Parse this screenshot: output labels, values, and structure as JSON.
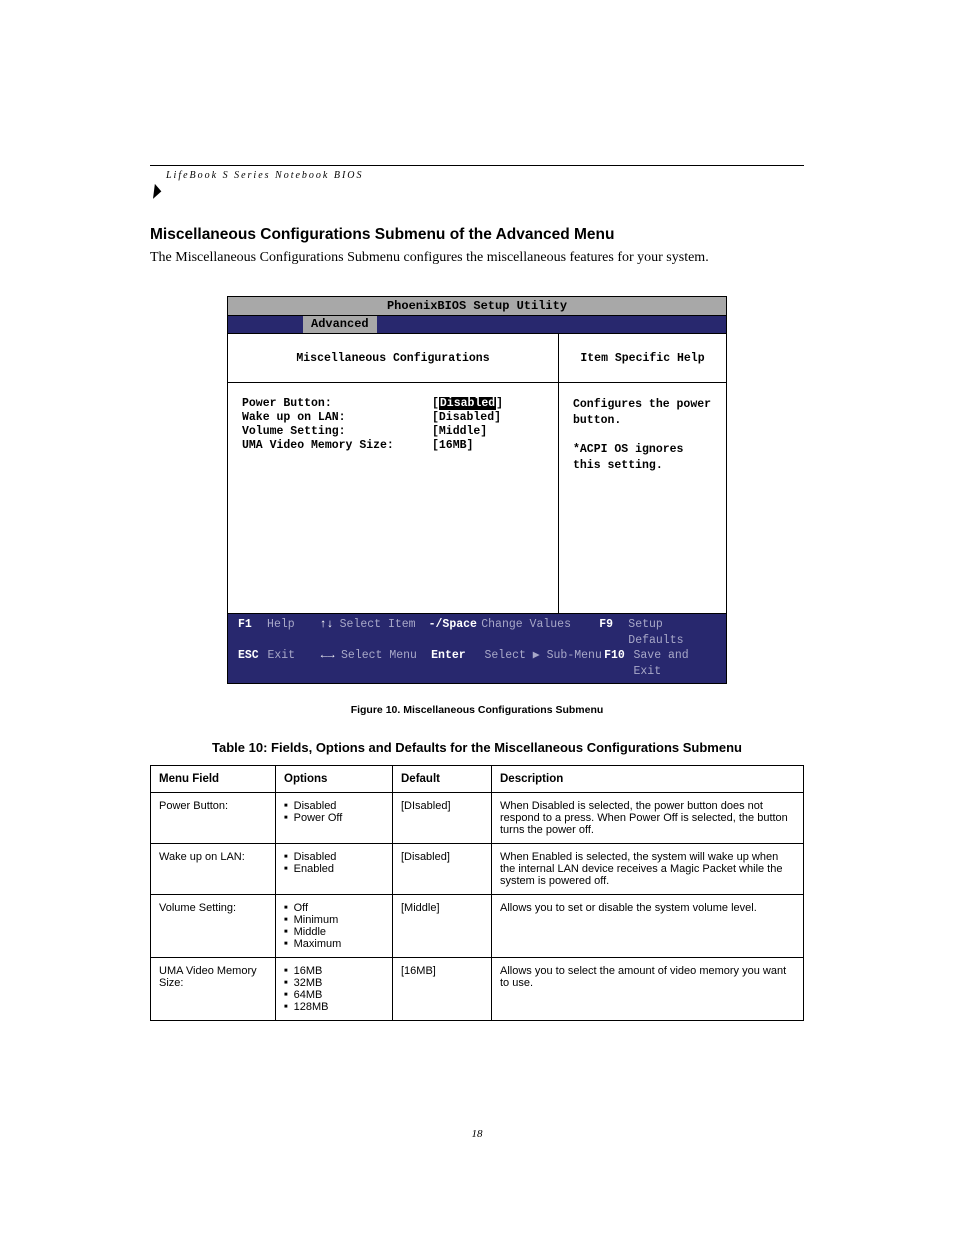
{
  "header_line": "LifeBook S Series Notebook BIOS",
  "section_title": "Miscellaneous Configurations Submenu of the Advanced Menu",
  "intro": "The Miscellaneous Configurations Submenu configures the miscellaneous features for your system.",
  "bios": {
    "title": "PhoenixBIOS Setup Utility",
    "active_tab": "Advanced",
    "left_header": "Miscellaneous Configurations",
    "right_header": "Item Specific Help",
    "fields": [
      {
        "label": "Power Button:",
        "value": "Disabled",
        "selected": true,
        "bracket": false
      },
      {
        "label": "Wake up on LAN:",
        "value": "[Disabled]",
        "selected": false
      },
      {
        "label": "Volume Setting:",
        "value": "[Middle]",
        "selected": false
      },
      {
        "label": "UMA Video Memory Size:",
        "value": "[16MB]",
        "selected": false
      }
    ],
    "help_text_1": "Configures the power button.",
    "help_text_2": "*ACPI OS ignores this setting.",
    "footer": {
      "r1": {
        "k1": "F1",
        "a1": "Help",
        "k2": "↑↓",
        "a2": "Select Item",
        "k3": "-/Space",
        "a3": "Change Values",
        "k4": "F9",
        "a4": "Setup Defaults"
      },
      "r2": {
        "k1": "ESC",
        "a1": "Exit",
        "k2": "←→",
        "a2": "Select Menu",
        "k3": "Enter",
        "a3": "Select ▶ Sub-Menu",
        "k4": "F10",
        "a4": "Save and Exit"
      }
    }
  },
  "figure_caption": "Figure 10.   Miscellaneous Configurations Submenu",
  "table_title": "Table 10: Fields, Options and Defaults for the Miscellaneous Configurations Submenu",
  "table": {
    "headers": {
      "menu": "Menu Field",
      "options": "Options",
      "def": "Default",
      "desc": "Description"
    },
    "rows": [
      {
        "menu": "Power Button:",
        "options": [
          "Disabled",
          "Power Off"
        ],
        "def": "[DIsabled]",
        "desc": "When Disabled is selected, the power button does not respond to a press. When Power Off is selected, the button turns the power off."
      },
      {
        "menu": "Wake up on LAN:",
        "options": [
          "Disabled",
          "Enabled"
        ],
        "def": "[Disabled]",
        "desc": "When Enabled is selected, the system will wake up when the internal LAN device receives a Magic Packet while the system is powered off."
      },
      {
        "menu": "Volume Setting:",
        "options": [
          "Off",
          "Minimum",
          "Middle",
          "Maximum"
        ],
        "def": "[Middle]",
        "desc": "Allows you to set or disable the system volume level."
      },
      {
        "menu": "UMA Video Memory Size:",
        "options": [
          "16MB",
          "32MB",
          "64MB",
          "128MB"
        ],
        "def": "[16MB]",
        "desc": "Allows you to select the amount of video memory you want to use."
      }
    ]
  },
  "page_number": "18"
}
